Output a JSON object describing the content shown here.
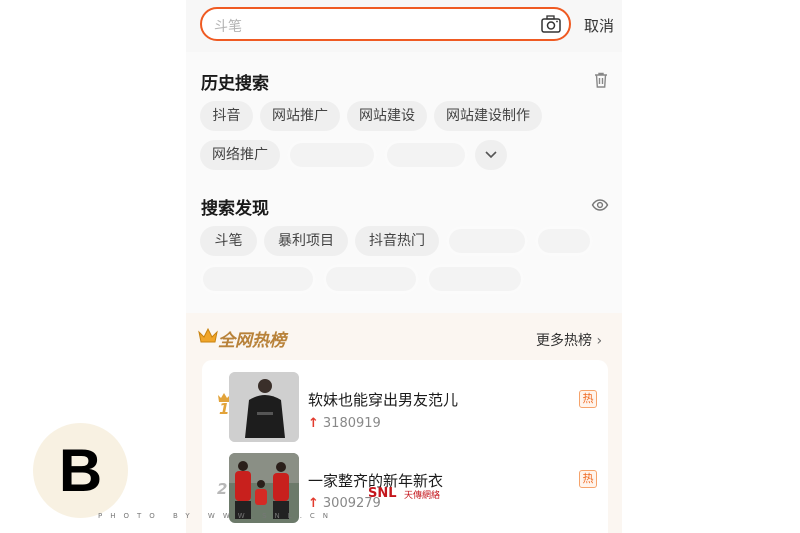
{
  "search": {
    "placeholder": "斗笔",
    "cancel_label": "取消"
  },
  "history": {
    "title": "历史搜索",
    "chips": [
      "抖音",
      "网站推广",
      "网站建设",
      "网站建设制作",
      "网络推广"
    ]
  },
  "discover": {
    "title": "搜索发现",
    "chips": [
      "斗笔",
      "暴利项目",
      "抖音热门"
    ]
  },
  "hot": {
    "title": "全网热榜",
    "more_label": "更多热榜",
    "items": [
      {
        "rank": "1",
        "title": "软妹也能穿出男友范儿",
        "count": "3180919",
        "badge": "热"
      },
      {
        "rank": "2",
        "title": "一家整齐的新年新衣",
        "count": "3009279",
        "badge": "热"
      }
    ]
  },
  "overlay": {
    "letter": "B",
    "watermark_logo": "SNL",
    "watermark_sub": "天傳網絡",
    "watermark_url": "PHOTO BY WWW.SNL.CN"
  },
  "colors": {
    "accent": "#ef5a22",
    "hot_gold": "#b8823a",
    "rank_gold": "#e2a33a",
    "rank_silver": "#b8b8b8"
  }
}
